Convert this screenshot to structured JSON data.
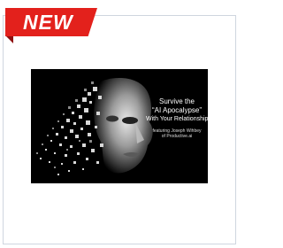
{
  "badge": {
    "label": "NEW",
    "color": "#e3211c"
  },
  "card": {
    "border_color": "#cfd6df",
    "thumbnail": {
      "title_line1": "Survive the",
      "title_line2": "“AI Apocalypse”",
      "title_line3": "With Your Relationships",
      "subtitle_line1": "featuring Joseph Wihbey",
      "subtitle_line2": "of Productive.ai",
      "background_color": "#000000"
    }
  }
}
